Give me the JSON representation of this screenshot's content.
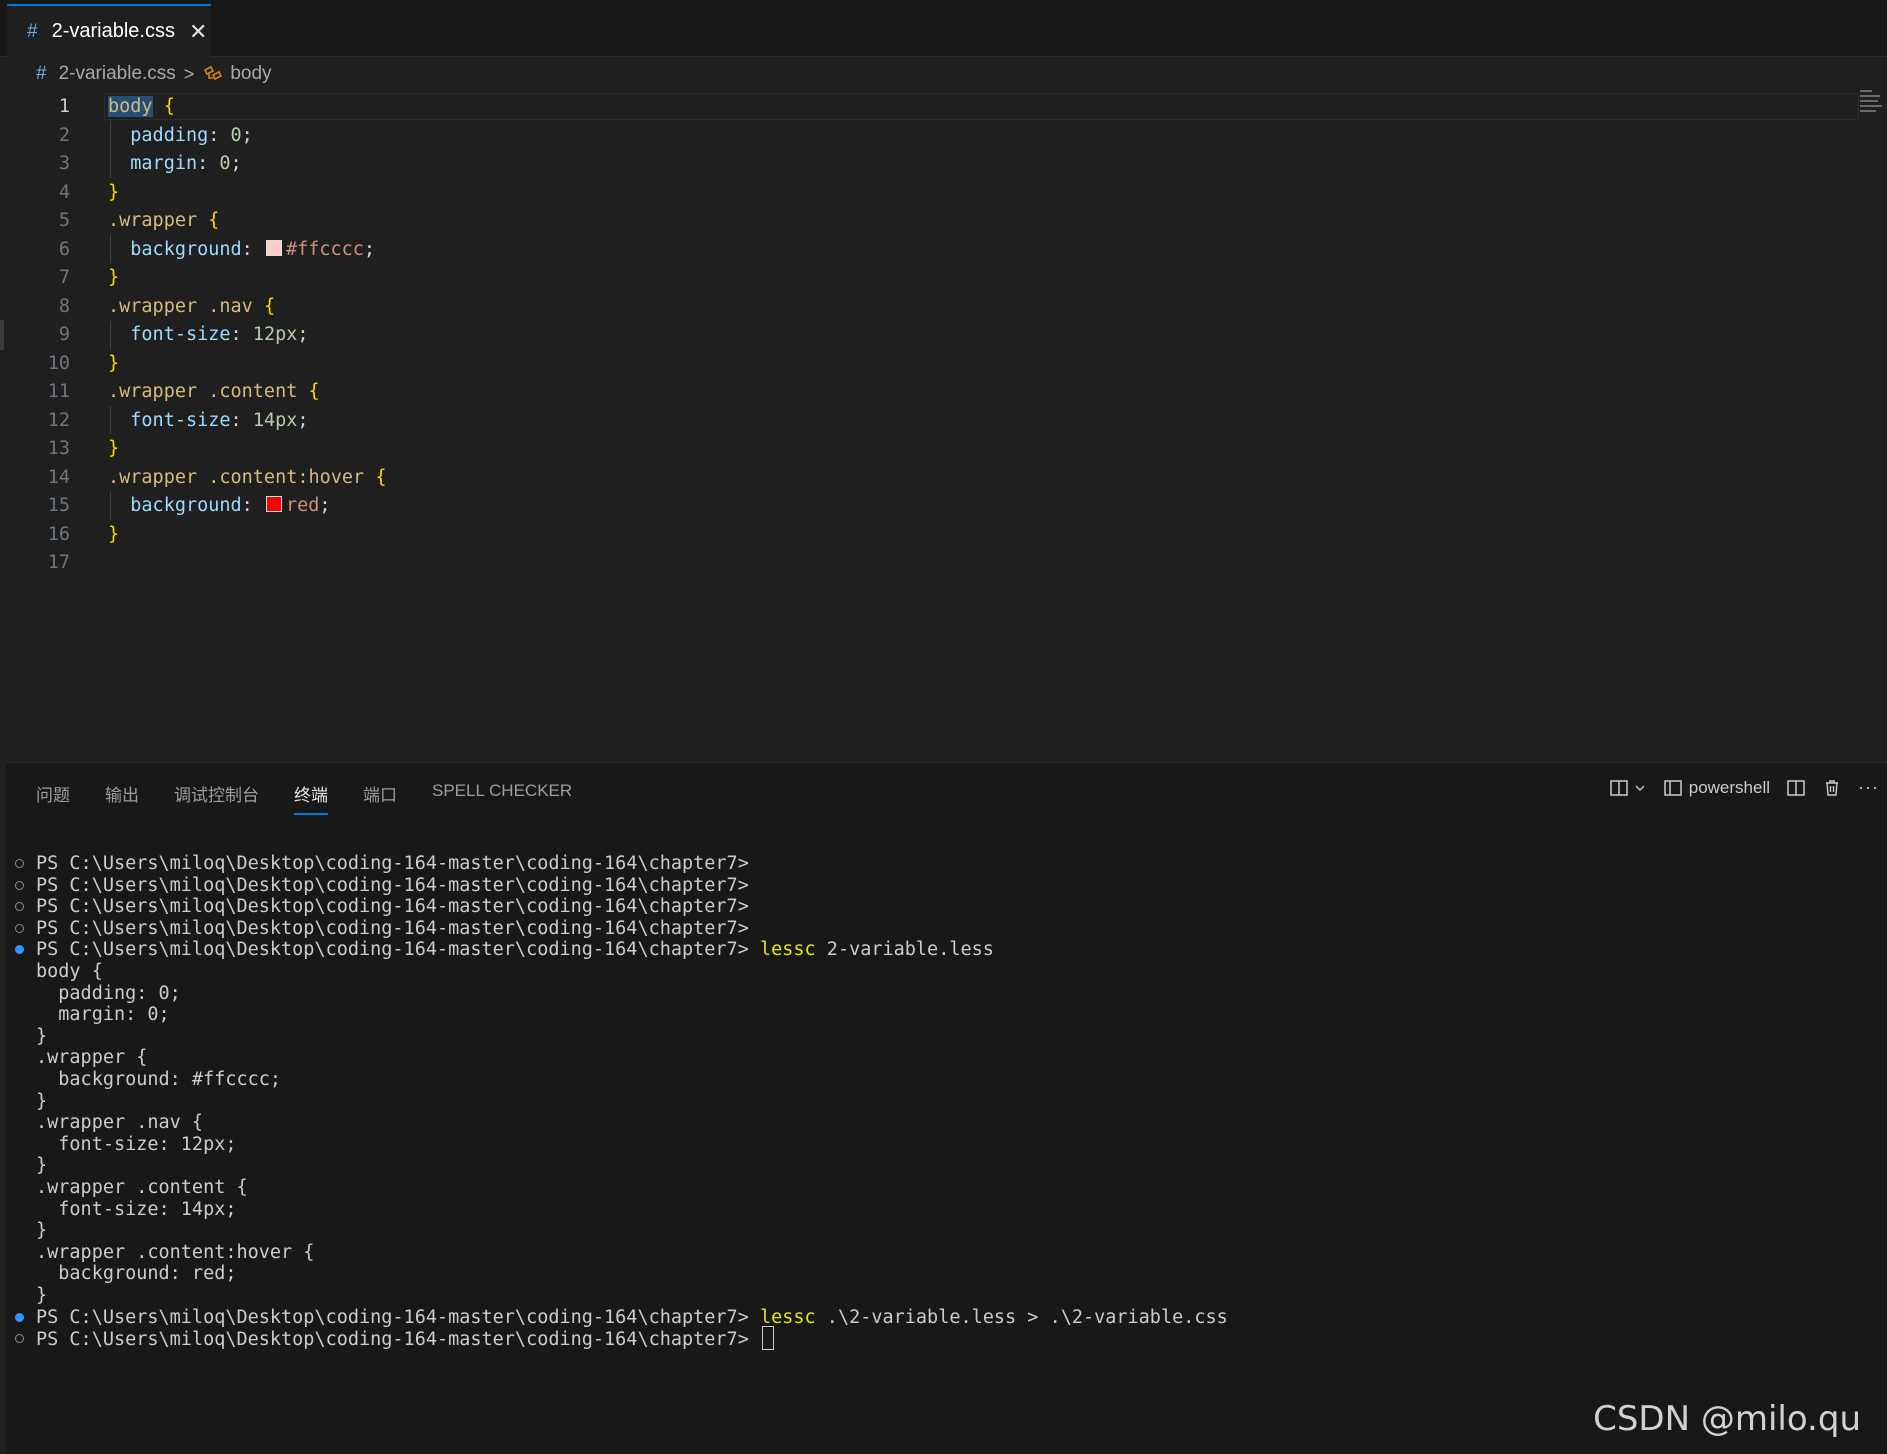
{
  "tab": {
    "icon": "#",
    "filename": "2-variable.css",
    "close": "✕"
  },
  "breadcrumb": {
    "icon": "#",
    "file": "2-variable.css",
    "separator": ">",
    "symbol": "body"
  },
  "editor": {
    "lines": [
      {
        "n": "1"
      },
      {
        "n": "2"
      },
      {
        "n": "3"
      },
      {
        "n": "4"
      },
      {
        "n": "5"
      },
      {
        "n": "6"
      },
      {
        "n": "7"
      },
      {
        "n": "8"
      },
      {
        "n": "9"
      },
      {
        "n": "10"
      },
      {
        "n": "11"
      },
      {
        "n": "12"
      },
      {
        "n": "13"
      },
      {
        "n": "14"
      },
      {
        "n": "15"
      },
      {
        "n": "16"
      },
      {
        "n": "17"
      }
    ],
    "code": {
      "l1_sel": "body",
      "l1_brace": " {",
      "l2_prop": "padding",
      "l2_val": "0",
      "l3_prop": "margin",
      "l3_val": "0",
      "close": "}",
      "l5_sel": ".wrapper",
      "l6_prop": "background",
      "l6_val": "#ffcccc",
      "l8_sel": ".wrapper .nav",
      "l9_prop": "font-size",
      "l9_val": "12px",
      "l11_sel": ".wrapper .content",
      "l12_prop": "font-size",
      "l12_val": "14px",
      "l14_sel": ".wrapper .content:hover",
      "l15_prop": "background",
      "l15_val": "red",
      "swatch1": "#ffcccc",
      "swatch2": "#ff0000"
    }
  },
  "panel": {
    "tabs": [
      {
        "label": "问题"
      },
      {
        "label": "输出"
      },
      {
        "label": "调试控制台"
      },
      {
        "label": "终端"
      },
      {
        "label": "端口"
      },
      {
        "label": "SPELL CHECKER"
      }
    ],
    "active_tab": "终端",
    "terminal_name": "powershell"
  },
  "terminal": {
    "prompt": "PS C:\\Users\\miloq\\Desktop\\coding-164-master\\coding-164\\chapter7>",
    "cmd1": "lessc",
    "cmd1_args": " 2-variable.less",
    "cmd2": "lessc",
    "cmd2_args": " .\\2-variable.less > .\\2-variable.css",
    "output": [
      "body {",
      "  padding: 0;",
      "  margin: 0;",
      "}",
      ".wrapper {",
      "  background: #ffcccc;",
      "}",
      ".wrapper .nav {",
      "  font-size: 12px;",
      "}",
      ".wrapper .content {",
      "  font-size: 14px;",
      "}",
      ".wrapper .content:hover {",
      "  background: red;",
      "}"
    ]
  },
  "watermark": "CSDN @milo.qu",
  "colors": {
    "accent": "#0078d4",
    "status_dot": "#3794ff"
  }
}
